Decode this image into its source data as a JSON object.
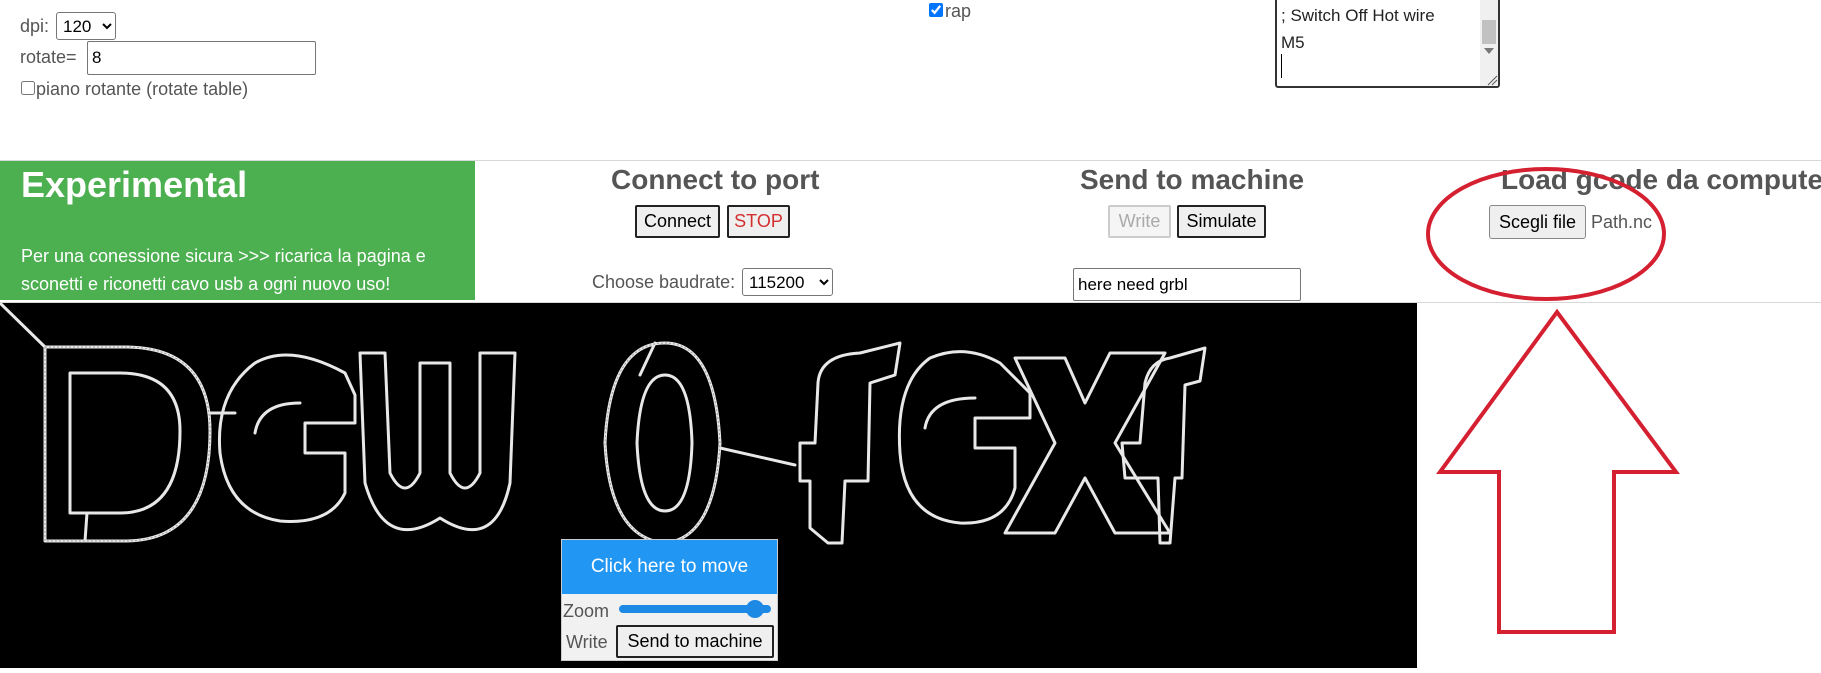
{
  "settings": {
    "dpi_label": "dpi:",
    "dpi_value": "120",
    "rotate_label": "rotate=",
    "rotate_value": "8",
    "rotate_table_label": "piano rotante (rotate table)",
    "rap_label": "rap"
  },
  "gcode_preview": {
    "lines": [
      "; Switch Off Hot wire",
      "M5"
    ]
  },
  "experimental": {
    "title": "Experimental",
    "text": "Per una conessione sicura >>> ricarica la pagina e sconetti e riconetti cavo usb a ogni nuovo uso!"
  },
  "connect": {
    "title": "Connect to port",
    "connect_label": "Connect",
    "stop_label": "STOP",
    "baudrate_label": "Choose baudrate:",
    "baudrate_value": "115200"
  },
  "send": {
    "title": "Send to machine",
    "write_label": "Write",
    "simulate_label": "Simulate",
    "status_value": "here need grbl"
  },
  "load": {
    "title": "Load gcode da computer",
    "choose_file_label": "Scegli file",
    "file_name": "Path.nc"
  },
  "move_panel": {
    "move_label": "Click here to move",
    "zoom_label": "Zoom",
    "zoom_level": 0.95,
    "write_label": "Write",
    "send_label": "Send to machine"
  },
  "annotation": {
    "color": "#d42030"
  }
}
